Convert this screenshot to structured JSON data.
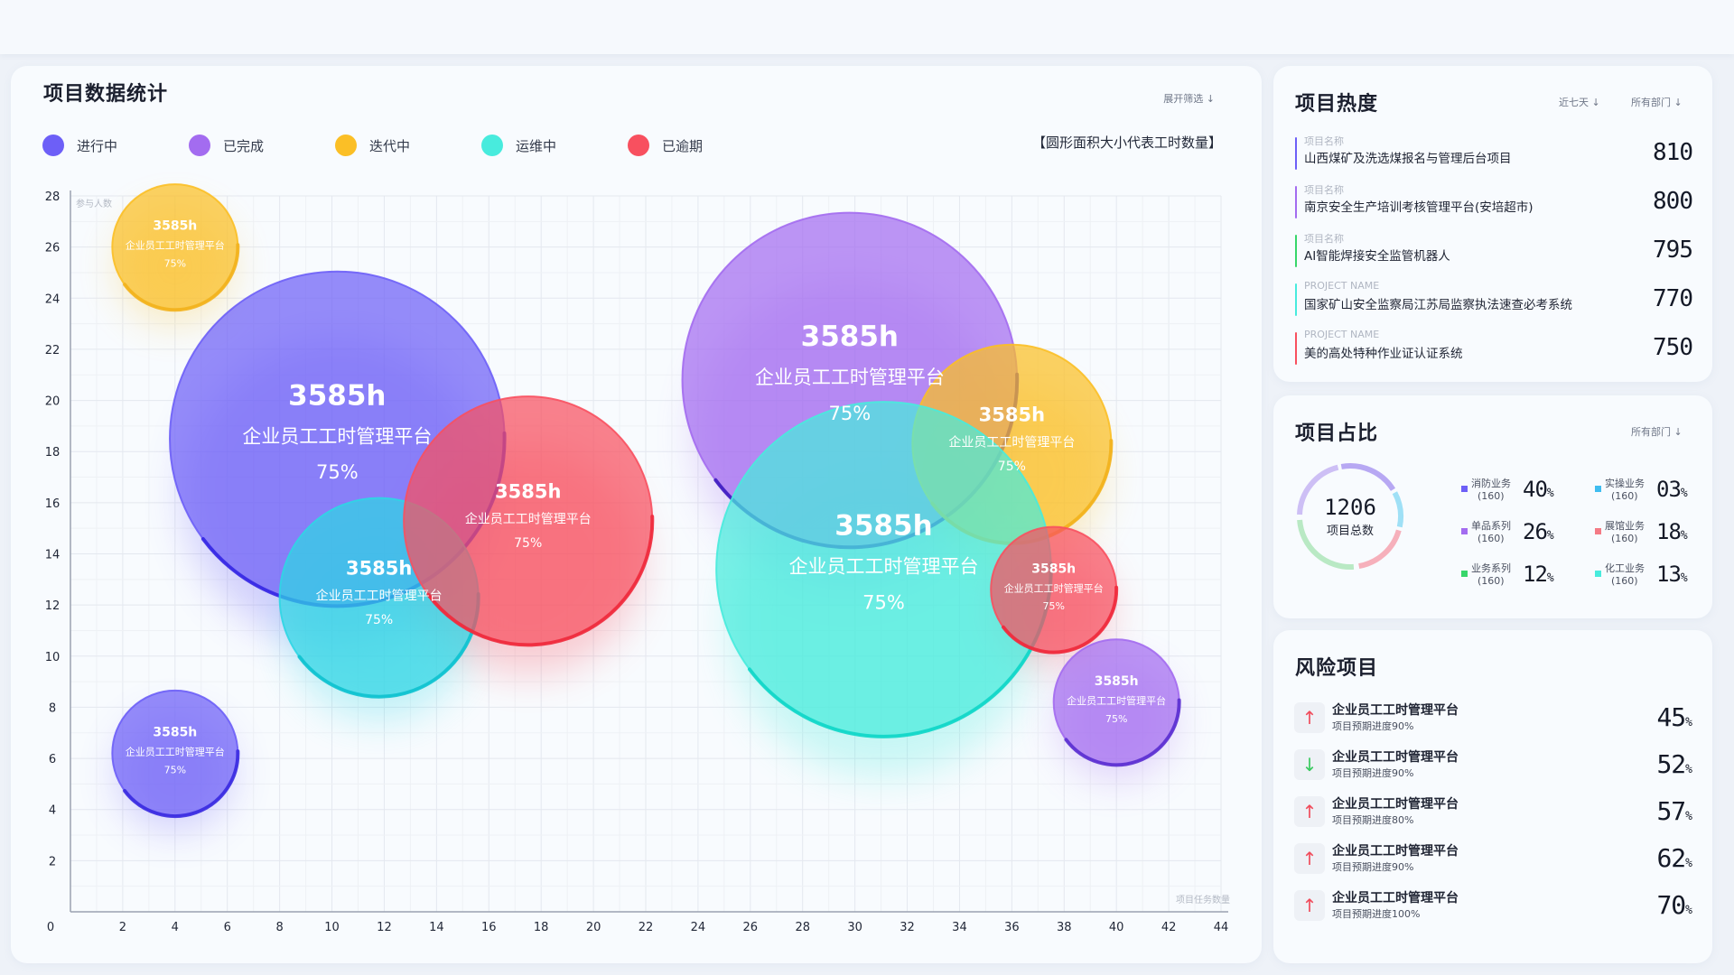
{
  "colors": {
    "进行中": "#6d5ff7",
    "已完成": "#a36cf0",
    "迭代中": "#fbbf26",
    "运维中": "#48ebdd",
    "已逾期": "#f8505f"
  },
  "main": {
    "title": "项目数据统计",
    "filter_link": "展开筛选 ↓",
    "note": "【圆形面积大小代表工时数量】",
    "legend": [
      {
        "label": "进行中",
        "color": "#6d5ff7"
      },
      {
        "label": "已完成",
        "color": "#a36cf0"
      },
      {
        "label": "迭代中",
        "color": "#fbbf26"
      },
      {
        "label": "运维中",
        "color": "#48ebdd"
      },
      {
        "label": "已逾期",
        "color": "#f8505f"
      }
    ]
  },
  "chart_data": {
    "type": "scatter",
    "subtype": "bubble",
    "ylabel": "参与人数",
    "xlabel": "项目任务数量",
    "xlim": [
      0,
      44
    ],
    "ylim": [
      0,
      28
    ],
    "x_ticks": [
      0,
      2,
      4,
      6,
      8,
      10,
      12,
      14,
      16,
      18,
      20,
      22,
      24,
      26,
      28,
      30,
      32,
      34,
      36,
      38,
      40,
      42,
      44
    ],
    "y_ticks": [
      0,
      2,
      4,
      6,
      8,
      10,
      12,
      14,
      16,
      18,
      20,
      22,
      24,
      26,
      28
    ],
    "grid": true,
    "size_note": "圆形面积大小代表工时数量",
    "points": [
      {
        "status": "迭代中",
        "x": 4,
        "y": 26,
        "r": 2.4,
        "hours": "3585h",
        "name": "企业员工工时管理平台",
        "pct": "75%",
        "color": "#fbbf26",
        "arc_color": "#f2b21e"
      },
      {
        "status": "进行中",
        "x": 10.2,
        "y": 18.5,
        "r": 6.4,
        "hours": "3585h",
        "name": "企业员工工时管理平台",
        "pct": "75%",
        "color": "#6d5ff7",
        "arc_color": "#3527e3"
      },
      {
        "status": "运维中",
        "x": 11.8,
        "y": 12.3,
        "r": 3.8,
        "hours": "3585h",
        "name": "企业员工工时管理平台",
        "pct": "75%",
        "color": "#2fd6e4",
        "arc_color": "#10c2cf"
      },
      {
        "status": "已逾期",
        "x": 17.5,
        "y": 15.3,
        "r": 4.75,
        "hours": "3585h",
        "name": "企业员工工时管理平台",
        "pct": "75%",
        "color": "#f8505f",
        "arc_color": "#ee2a3c"
      },
      {
        "status": "进行中",
        "x": 4,
        "y": 6.2,
        "r": 2.4,
        "hours": "3585h",
        "name": "企业员工工时管理平台",
        "pct": "75%",
        "color": "#6d5ff7",
        "arc_color": "#3a2be0"
      },
      {
        "status": "已完成",
        "x": 29.8,
        "y": 20.8,
        "r": 6.4,
        "hours": "3585h",
        "name": "企业员工工时管理平台",
        "pct": "75%",
        "color": "#a36cf0",
        "arc_color": "#3d1bc0"
      },
      {
        "status": "迭代中",
        "x": 36,
        "y": 18.3,
        "r": 3.8,
        "hours": "3585h",
        "name": "企业员工工时管理平台",
        "pct": "75%",
        "color": "#fbbf26",
        "arc_color": "#f2b21e"
      },
      {
        "status": "运维中",
        "x": 31.1,
        "y": 13.4,
        "r": 6.4,
        "hours": "3585h",
        "name": "企业员工工时管理平台",
        "pct": "75%",
        "color": "#48ebdd",
        "arc_color": "#10d6c8"
      },
      {
        "status": "已逾期",
        "x": 37.6,
        "y": 12.6,
        "r": 2.4,
        "hours": "3585h",
        "name": "企业员工工时管理平台",
        "pct": "75%",
        "color": "#f8505f",
        "arc_color": "#ee2a3c"
      },
      {
        "status": "已完成",
        "x": 40,
        "y": 8.2,
        "r": 2.4,
        "hours": "3585h",
        "name": "企业员工工时管理平台",
        "pct": "75%",
        "color": "#a36cf0",
        "arc_color": "#5a2fd0"
      }
    ]
  },
  "hot": {
    "title": "项目热度",
    "filter_days": "近七天 ↓",
    "filter_dept": "所有部门 ↓",
    "items": [
      {
        "sub": "项目名称",
        "name": "山西煤矿及洗选煤报名与管理后台项目",
        "value": "810",
        "color": "#6d5ff7"
      },
      {
        "sub": "项目名称",
        "name": "南京安全生产培训考核管理平台(安培超市)",
        "value": "800",
        "color": "#a36cf0"
      },
      {
        "sub": "项目名称",
        "name": "AI智能焊接安全监管机器人",
        "value": "795",
        "color": "#38d66a"
      },
      {
        "sub": "PROJECT NAME",
        "name": "国家矿山安全监察局江苏局监察执法速查必考系统",
        "value": "770",
        "color": "#48ebdd"
      },
      {
        "sub": "PROJECT NAME",
        "name": "美的高处特种作业证认证系统",
        "value": "750",
        "color": "#f8505f"
      }
    ]
  },
  "share": {
    "title": "项目占比",
    "filter_dept": "所有部门 ↓",
    "total": "1206",
    "total_label": "项目总数",
    "items": [
      {
        "name": "消防业务",
        "count": "(160)",
        "pct": "40",
        "color": "#6d5ff7"
      },
      {
        "name": "实操业务",
        "count": "(160)",
        "pct": "03",
        "color": "#3fbdf0"
      },
      {
        "name": "单品系列",
        "count": "(160)",
        "pct": "26",
        "color": "#a36cf0"
      },
      {
        "name": "展馆业务",
        "count": "(160)",
        "pct": "18",
        "color": "#f47a85"
      },
      {
        "name": "业务系列",
        "count": "(160)",
        "pct": "12",
        "color": "#38d66a"
      },
      {
        "name": "化工业务",
        "count": "(160)",
        "pct": "13",
        "color": "#48ebdd"
      }
    ],
    "ring_colors": [
      "#b7a8f3",
      "#9fe0f6",
      "#f6b0bb",
      "#b9e9c4",
      "#cdbff5"
    ]
  },
  "risk": {
    "title": "风险项目",
    "items": [
      {
        "name": "企业员工工时管理平台",
        "sub": "项目预期进度90%",
        "value": "45",
        "trend": "up",
        "icon": "↑"
      },
      {
        "name": "企业员工工时管理平台",
        "sub": "项目预期进度90%",
        "value": "52",
        "trend": "down",
        "icon": "↓"
      },
      {
        "name": "企业员工工时管理平台",
        "sub": "项目预期进度80%",
        "value": "57",
        "trend": "up",
        "icon": "↑"
      },
      {
        "name": "企业员工工时管理平台",
        "sub": "项目预期进度90%",
        "value": "62",
        "trend": "up",
        "icon": "↑"
      },
      {
        "name": "企业员工工时管理平台",
        "sub": "项目预期进度100%",
        "value": "70",
        "trend": "up",
        "icon": "↑"
      }
    ]
  }
}
